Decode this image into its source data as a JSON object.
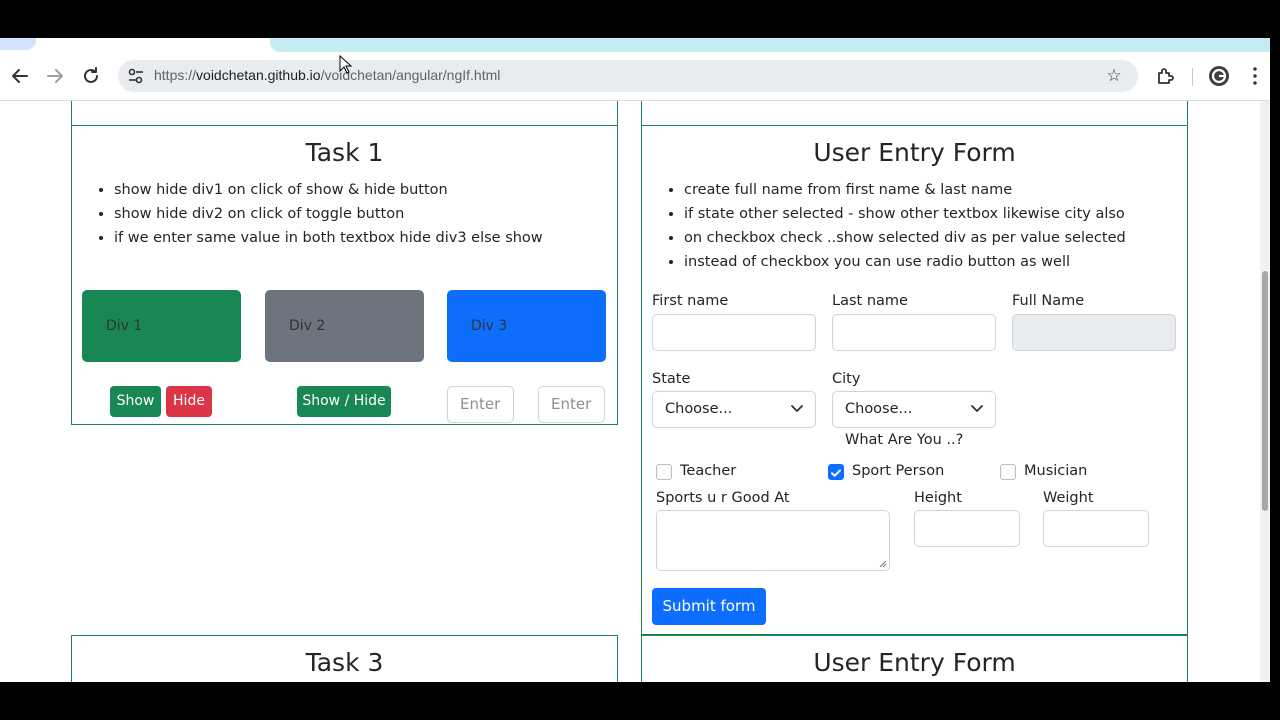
{
  "browser": {
    "url_prefix": "https://",
    "url_host": "voidchetan.github.io",
    "url_path": "/voidchetan/angular/ngIf.html"
  },
  "task1": {
    "title": "Task 1",
    "bullets": [
      "show hide div1 on click of show & hide button",
      "show hide div2 on click of toggle button",
      "if we enter same value in both textbox hide div3 else show"
    ],
    "div1": "Div 1",
    "div2": "Div 2",
    "div3": "Div 3",
    "show_label": "Show",
    "hide_label": "Hide",
    "toggle_label": "Show / Hide",
    "input1_placeholder": "Enter",
    "input2_placeholder": "Enter",
    "colors": {
      "green": "#198754",
      "gray": "#6c757d",
      "blue": "#0d6efd",
      "red": "#dc3545"
    }
  },
  "form": {
    "title": "User Entry Form",
    "bullets": [
      "create full name from first name & last name",
      "if state other selected - show other textbox likewise city also",
      "on checkbox check ..show selected div as per value selected",
      "instead of checkbox you can use radio button as well"
    ],
    "first_name_label": "First name",
    "last_name_label": "Last name",
    "full_name_label": "Full Name",
    "state_label": "State",
    "state_value": "Choose...",
    "city_label": "City",
    "city_value": "Choose...",
    "what_are_you": "What Are You ..?",
    "teacher_label": "Teacher",
    "sport_label": "Sport Person",
    "musician_label": "Musician",
    "teacher_checked": false,
    "sport_checked": true,
    "musician_checked": false,
    "sports_good_label": "Sports u r Good At",
    "height_label": "Height",
    "weight_label": "Weight",
    "submit_label": "Submit form"
  },
  "task3": {
    "title": "Task 3"
  },
  "form2": {
    "title": "User Entry Form"
  }
}
